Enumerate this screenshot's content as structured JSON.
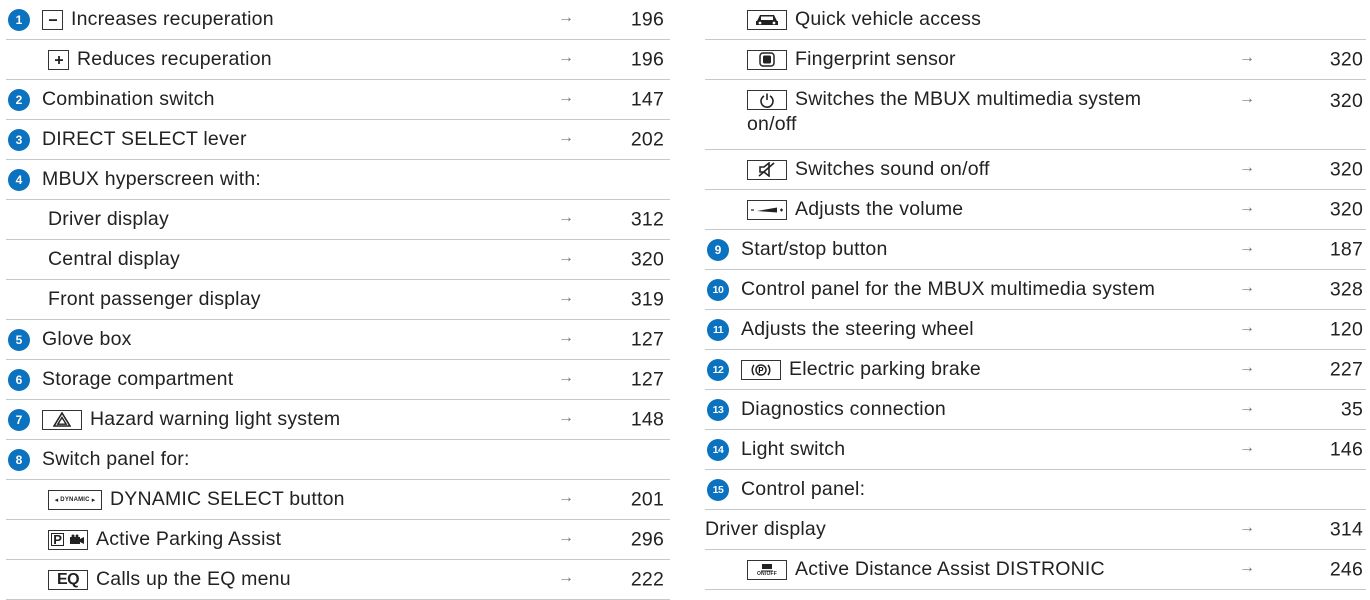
{
  "left": [
    {
      "num": "1",
      "key": "minus",
      "label": "Increases recuperation",
      "page": "196"
    },
    {
      "indent": true,
      "key": "plus",
      "label": "Reduces recuperation",
      "page": "196"
    },
    {
      "num": "2",
      "label": "Combination switch",
      "page": "147"
    },
    {
      "num": "3",
      "label": "DIRECT SELECT lever",
      "page": "202"
    },
    {
      "num": "4",
      "label": "MBUX hyperscreen with:",
      "page": ""
    },
    {
      "indent": true,
      "label": "Driver display",
      "page": "312"
    },
    {
      "indent": true,
      "label": "Central display",
      "page": "320"
    },
    {
      "indent": true,
      "label": "Front passenger display",
      "page": "319"
    },
    {
      "num": "5",
      "label": "Glove box",
      "page": "127"
    },
    {
      "num": "6",
      "label": "Storage compartment",
      "page": "127"
    },
    {
      "num": "7",
      "key": "hazard",
      "label": "Hazard warning light system",
      "page": "148"
    },
    {
      "num": "8",
      "label": "Switch panel for:",
      "page": ""
    },
    {
      "indent": true,
      "key": "dynamic",
      "key_text": "DYNAMIC",
      "label": "DYNAMIC SELECT button",
      "page": "201"
    },
    {
      "indent": true,
      "key": "parking",
      "key_text": "P",
      "label": "Active Parking Assist",
      "page": "296"
    },
    {
      "indent": true,
      "key": "eq",
      "key_text": "EQ",
      "label": "Calls up the EQ menu",
      "page": "222"
    }
  ],
  "right": [
    {
      "indent": true,
      "key": "car",
      "label": "Quick vehicle access",
      "page": ""
    },
    {
      "indent": true,
      "key": "fingerprint",
      "label": "Fingerprint sensor",
      "page": "320"
    },
    {
      "indent": true,
      "key": "power",
      "label": "Switches the MBUX multimedia system on/off",
      "page": "320",
      "tall": true
    },
    {
      "indent": true,
      "key": "mute",
      "label": "Switches sound on/off",
      "page": "320"
    },
    {
      "indent": true,
      "key": "volume",
      "label": "Adjusts the volume",
      "page": "320"
    },
    {
      "num": "9",
      "label": "Start/stop button",
      "page": "187"
    },
    {
      "num": "10",
      "label": "Control panel for the MBUX multimedia system",
      "page": "328"
    },
    {
      "num": "11",
      "label": "Adjusts the steering wheel",
      "page": "120"
    },
    {
      "num": "12",
      "key": "pbrake",
      "key_text": "P",
      "label": "Electric parking brake",
      "page": "227"
    },
    {
      "num": "13",
      "label": "Diagnostics connection",
      "page": "35"
    },
    {
      "num": "14",
      "label": "Light switch",
      "page": "146"
    },
    {
      "num": "15",
      "label": "Control panel:",
      "page": ""
    },
    {
      "label": "Driver display",
      "page": "314"
    },
    {
      "indent": true,
      "key": "distronic",
      "key_text": "ON/OFF",
      "label": "Active Distance Assist DISTRONIC",
      "page": "246"
    }
  ],
  "arrow_glyph": "→",
  "colors": {
    "accent": "#0b72c0",
    "rule": "#c8c8c8",
    "text": "#222222"
  }
}
